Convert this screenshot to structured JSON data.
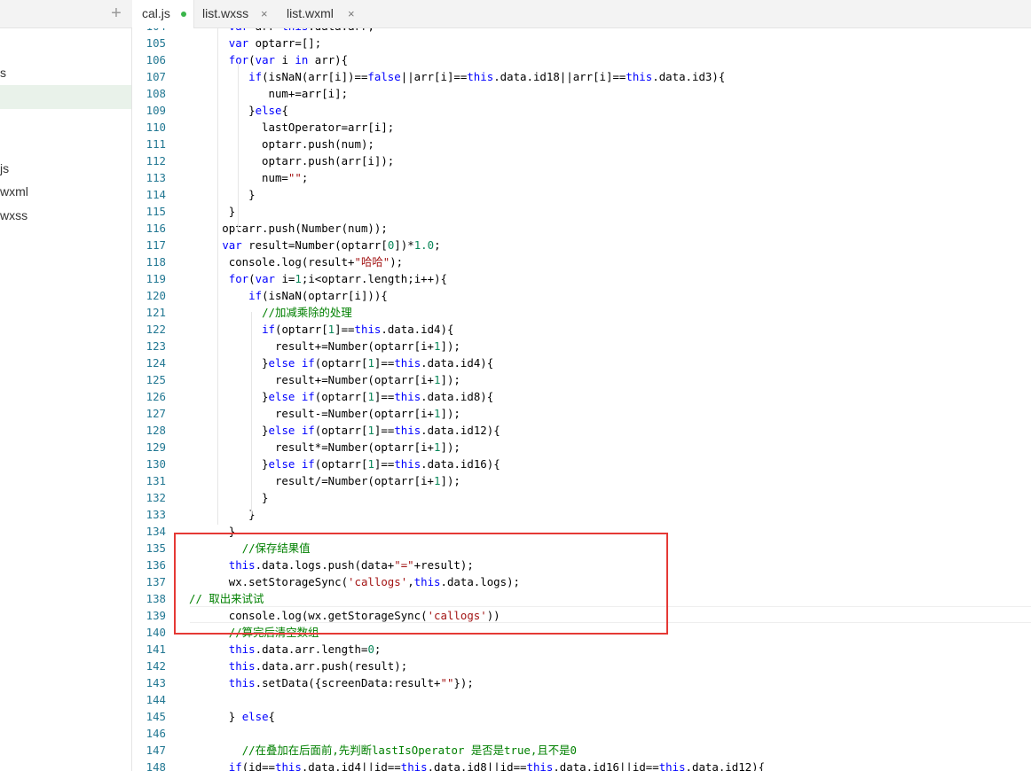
{
  "sidebar": {
    "items": [
      {
        "label": "s",
        "selected": false
      },
      {
        "label": "",
        "selected": true
      },
      {
        "label": "js",
        "selected": false
      },
      {
        "label": "wxml",
        "selected": false
      },
      {
        "label": "wxss",
        "selected": false
      }
    ]
  },
  "tabs": [
    {
      "label": "cal.js",
      "active": true,
      "modified": true
    },
    {
      "label": "list.wxss",
      "active": false,
      "modified": false
    },
    {
      "label": "list.wxml",
      "active": false,
      "modified": false
    }
  ],
  "tab_close_glyph": "×",
  "add_glyph": "+",
  "colors": {
    "keyword": "#0000ff",
    "string": "#a31515",
    "number": "#098658",
    "comment": "#008000",
    "line_number": "#237893",
    "highlight_box": "#e53935",
    "modified_dot": "#3ab54a"
  },
  "editor": {
    "lines": [
      {
        "n": "104",
        "t": "      var arr=this.data.arr;"
      },
      {
        "n": "105",
        "t": "      var optarr=[];"
      },
      {
        "n": "106",
        "t": "      for(var i in arr){"
      },
      {
        "n": "107",
        "t": "         if(isNaN(arr[i])==false||arr[i]==this.data.id18||arr[i]==this.data.id3){"
      },
      {
        "n": "108",
        "t": "            num+=arr[i];"
      },
      {
        "n": "109",
        "t": "         }else{"
      },
      {
        "n": "110",
        "t": "           lastOperator=arr[i];"
      },
      {
        "n": "111",
        "t": "           optarr.push(num);"
      },
      {
        "n": "112",
        "t": "           optarr.push(arr[i]);"
      },
      {
        "n": "113",
        "t": "           num=\"\";"
      },
      {
        "n": "114",
        "t": "         }"
      },
      {
        "n": "115",
        "t": "      }"
      },
      {
        "n": "116",
        "t": "     optarr.push(Number(num));"
      },
      {
        "n": "117",
        "t": "     var result=Number(optarr[0])*1.0;"
      },
      {
        "n": "118",
        "t": "      console.log(result+\"哈哈\");"
      },
      {
        "n": "119",
        "t": "      for(var i=1;i<optarr.length;i++){"
      },
      {
        "n": "120",
        "t": "         if(isNaN(optarr[i])){"
      },
      {
        "n": "121",
        "t": "           //加减乘除的处理"
      },
      {
        "n": "122",
        "t": "           if(optarr[1]==this.data.id4){"
      },
      {
        "n": "123",
        "t": "             result+=Number(optarr[i+1]);"
      },
      {
        "n": "124",
        "t": "           }else if(optarr[1]==this.data.id4){"
      },
      {
        "n": "125",
        "t": "             result+=Number(optarr[i+1]);"
      },
      {
        "n": "126",
        "t": "           }else if(optarr[1]==this.data.id8){"
      },
      {
        "n": "127",
        "t": "             result-=Number(optarr[i+1]);"
      },
      {
        "n": "128",
        "t": "           }else if(optarr[1]==this.data.id12){"
      },
      {
        "n": "129",
        "t": "             result*=Number(optarr[i+1]);"
      },
      {
        "n": "130",
        "t": "           }else if(optarr[1]==this.data.id16){"
      },
      {
        "n": "131",
        "t": "             result/=Number(optarr[i+1]);"
      },
      {
        "n": "132",
        "t": "           }"
      },
      {
        "n": "133",
        "t": "         }"
      },
      {
        "n": "134",
        "t": "      }"
      },
      {
        "n": "135",
        "t": "        //保存结果值"
      },
      {
        "n": "136",
        "t": "      this.data.logs.push(data+\"=\"+result);"
      },
      {
        "n": "137",
        "t": "      wx.setStorageSync('callogs',this.data.logs);"
      },
      {
        "n": "138",
        "t": "// 取出来试试"
      },
      {
        "n": "139",
        "t": "      console.log(wx.getStorageSync('callogs'))"
      },
      {
        "n": "140",
        "t": "      //算完后清空数组"
      },
      {
        "n": "141",
        "t": "      this.data.arr.length=0;"
      },
      {
        "n": "142",
        "t": "      this.data.arr.push(result);"
      },
      {
        "n": "143",
        "t": "      this.setData({screenData:result+\"\"});"
      },
      {
        "n": "144",
        "t": ""
      },
      {
        "n": "145",
        "t": "      } else{"
      },
      {
        "n": "146",
        "t": ""
      },
      {
        "n": "147",
        "t": "        //在叠加在后面前,先判断lastIsOperator 是否是true,且不是0"
      },
      {
        "n": "148",
        "t": "      if(id==this.data.id4||id==this.data.id8||id==this.data.id16||id==this.data.id12){"
      }
    ]
  }
}
